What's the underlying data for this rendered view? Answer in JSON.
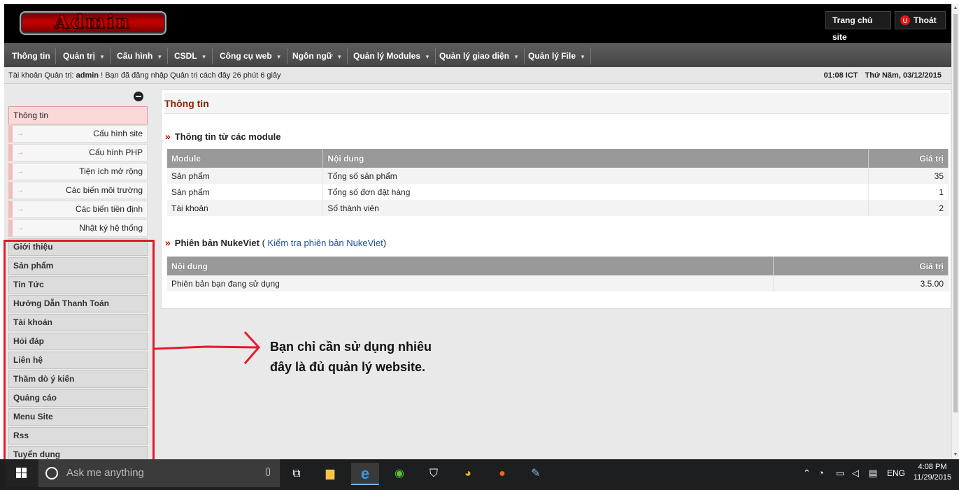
{
  "header": {
    "logo_text": "Admin",
    "home_btn": "Trang chủ site",
    "logout_btn": "Thoát"
  },
  "menu": [
    {
      "label": "Thông tin",
      "has_sub": false
    },
    {
      "label": "Quản trị",
      "has_sub": true
    },
    {
      "label": "Cấu hình",
      "has_sub": true
    },
    {
      "label": "CSDL",
      "has_sub": true
    },
    {
      "label": "Công cụ web",
      "has_sub": true
    },
    {
      "label": "Ngôn ngữ",
      "has_sub": true
    },
    {
      "label": "Quản lý Modules",
      "has_sub": true
    },
    {
      "label": "Quản lý giao diện",
      "has_sub": true
    },
    {
      "label": "Quản lý File",
      "has_sub": true
    }
  ],
  "status": {
    "prefix": "Tài khoản Quản trị:",
    "user": "admin",
    "suffix": "! Bạn đã đăng nhập Quản trị cách đây 26 phút 6 giây",
    "time": "01:08 ICT",
    "date": "Thứ Năm, 03/12/2015"
  },
  "sidebar": {
    "active": "Thông tin",
    "subitems": [
      "Cấu hình site",
      "Cấu hình PHP",
      "Tiện ích mở rộng",
      "Các biến môi trường",
      "Các biến tiền định",
      "Nhật ký hệ thống"
    ],
    "modules": [
      "Giới thiệu",
      "Sản phẩm",
      "Tin Tức",
      "Hướng Dẫn Thanh Toán",
      "Tài khoản",
      "Hỏi đáp",
      "Liên hệ",
      "Thăm dò ý kiến",
      "Quảng cáo",
      "Menu Site",
      "Rss",
      "Tuyển dụng"
    ]
  },
  "main": {
    "title": "Thông tin",
    "section1": {
      "title": "Thông tin từ các module",
      "headers": [
        "Module",
        "Nội dung",
        "Giá trị"
      ],
      "rows": [
        [
          "Sản phẩm",
          "Tổng số sản phẩm",
          "35"
        ],
        [
          "Sản phẩm",
          "Tổng số đơn đặt hàng",
          "1"
        ],
        [
          "Tài khoản",
          "Số thành viên",
          "2"
        ]
      ]
    },
    "section2": {
      "title": "Phiên bản NukeViet",
      "link": "Kiểm tra phiên bản NukeViet",
      "headers": [
        "Nội dung",
        "Giá trị"
      ],
      "rows": [
        [
          "Phiên bản bạn đang sử dụng",
          "3.5.00"
        ]
      ]
    }
  },
  "annotation": {
    "line1": "Bạn chỉ cần sử dụng nhiêu",
    "line2": "đây là đủ quản lý website."
  },
  "taskbar": {
    "search_placeholder": "Ask me anything",
    "lang": "ENG",
    "time": "4:08 PM",
    "date": "11/29/2015"
  }
}
